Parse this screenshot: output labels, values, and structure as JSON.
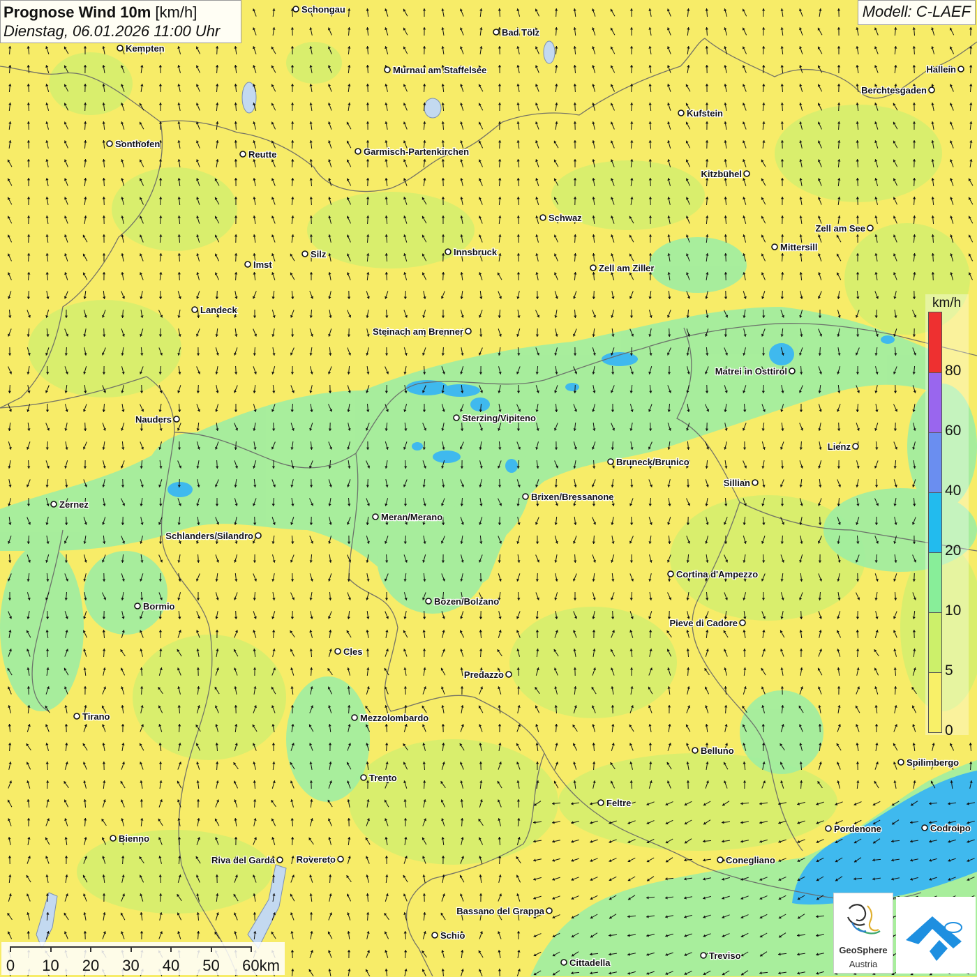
{
  "header": {
    "title_bold": "Prognose Wind 10m",
    "title_unit": "[km/h]",
    "datetime": "Dienstag, 06.01.2026 11:00 Uhr"
  },
  "model": "Modell: C-LAEF",
  "legend": {
    "unit": "km/h",
    "labels": [
      "80",
      "60",
      "40",
      "20",
      "10",
      "5",
      "0"
    ],
    "colors": [
      "#ee3030",
      "#9966ee",
      "#6a8ef0",
      "#22bbee",
      "#88ee99",
      "#ccf06a",
      "#f8f068"
    ]
  },
  "scalebar": {
    "labels": [
      "0",
      "10",
      "20",
      "30",
      "40",
      "50",
      "60km"
    ]
  },
  "logo": {
    "name_line1": "GeoSphere",
    "name_line2": "Austria"
  },
  "colors": {
    "calm_yellow": "#f7ec68",
    "light_green": "#d4ef6e",
    "green": "#9feea2",
    "blue": "#3fb9ee",
    "arrow": "#111111",
    "border": "#666666"
  },
  "cities": [
    {
      "name": "Schongau",
      "side": "right"
    },
    {
      "name": "Bad Tölz",
      "side": "right"
    },
    {
      "name": "Kempten",
      "side": "right"
    },
    {
      "name": "Murnau am Staffelsee",
      "side": "right"
    },
    {
      "name": "Hallein",
      "side": "left"
    },
    {
      "name": "Berchtesgaden",
      "side": "left"
    },
    {
      "name": "Kufstein",
      "side": "right"
    },
    {
      "name": "Sonthofen",
      "side": "right"
    },
    {
      "name": "Reutte",
      "side": "right"
    },
    {
      "name": "Garmisch-Partenkirchen",
      "side": "right"
    },
    {
      "name": "Kitzbühel",
      "side": "left"
    },
    {
      "name": "Schwaz",
      "side": "right"
    },
    {
      "name": "Zell am See",
      "side": "left"
    },
    {
      "name": "Mittersill",
      "side": "right"
    },
    {
      "name": "Innsbruck",
      "side": "right"
    },
    {
      "name": "Silz",
      "side": "right"
    },
    {
      "name": "Imst",
      "side": "right"
    },
    {
      "name": "Zell am Ziller",
      "side": "right"
    },
    {
      "name": "Landeck",
      "side": "right"
    },
    {
      "name": "Steinach am Brenner",
      "side": "left"
    },
    {
      "name": "Matrei in Osttirol",
      "side": "left"
    },
    {
      "name": "Nauders",
      "side": "left"
    },
    {
      "name": "Sterzing/Vipiteno",
      "side": "right"
    },
    {
      "name": "Lienz",
      "side": "left"
    },
    {
      "name": "Bruneck/Brunico",
      "side": "right"
    },
    {
      "name": "Sillian",
      "side": "left"
    },
    {
      "name": "Brixen/Bressanone",
      "side": "right"
    },
    {
      "name": "Zernez",
      "side": "right"
    },
    {
      "name": "Meran/Merano",
      "side": "right"
    },
    {
      "name": "Schlanders/Silandro",
      "side": "left"
    },
    {
      "name": "Cortina d'Ampezzo",
      "side": "right"
    },
    {
      "name": "Bormio",
      "side": "right"
    },
    {
      "name": "Bozen/Bolzano",
      "side": "right"
    },
    {
      "name": "Pieve di Cadore",
      "side": "left"
    },
    {
      "name": "Cles",
      "side": "right"
    },
    {
      "name": "Predazzo",
      "side": "left"
    },
    {
      "name": "Tirano",
      "side": "right"
    },
    {
      "name": "Mezzolombardo",
      "side": "right"
    },
    {
      "name": "Belluno",
      "side": "right"
    },
    {
      "name": "Spilimbergo",
      "side": "right"
    },
    {
      "name": "Trento",
      "side": "right"
    },
    {
      "name": "Feltre",
      "side": "right"
    },
    {
      "name": "Pordenone",
      "side": "right"
    },
    {
      "name": "Codroipo",
      "side": "right"
    },
    {
      "name": "Bienno",
      "side": "right"
    },
    {
      "name": "Riva del Garda",
      "side": "left"
    },
    {
      "name": "Rovereto",
      "side": "left"
    },
    {
      "name": "Conegliano",
      "side": "right"
    },
    {
      "name": "Bassano del Grappa",
      "side": "left"
    },
    {
      "name": "Schio",
      "side": "right"
    },
    {
      "name": "Treviso",
      "side": "right"
    },
    {
      "name": "Cittadella",
      "side": "right"
    }
  ]
}
